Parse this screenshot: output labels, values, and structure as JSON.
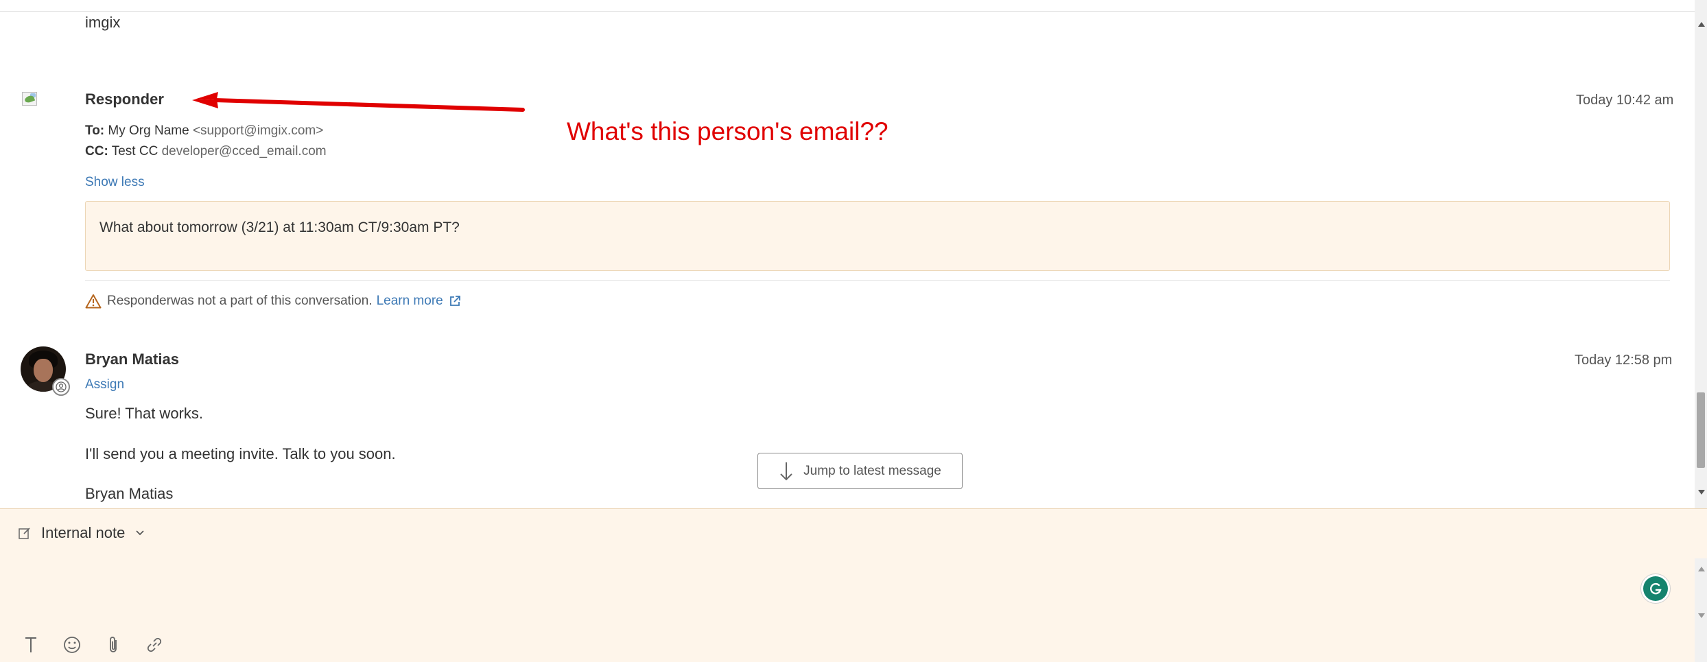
{
  "previous_message": {
    "signature": "imgix"
  },
  "responder_message": {
    "sender": "Responder",
    "time": "Today 10:42 am",
    "to_label": "To:",
    "to_name": "My Org Name",
    "to_email": "<support@imgix.com>",
    "cc_label": "CC:",
    "cc_name": "Test CC",
    "cc_email": "developer@cced_email.com",
    "show_less": "Show less",
    "body": "What about tomorrow (3/21) at 11:30am CT/9:30am PT?",
    "warning_text": "Responderwas not a part of this conversation.",
    "learn_more": "Learn more"
  },
  "annotation": {
    "text": "What's this person's email??",
    "color": "#e00000"
  },
  "bryan_message": {
    "sender": "Bryan Matias",
    "time": "Today 12:58 pm",
    "assign": "Assign",
    "lines": [
      "Sure! That works.",
      "I'll send you a meeting invite. Talk to you soon.",
      "Bryan Matias"
    ]
  },
  "jump_button": {
    "label": "Jump to latest message",
    "icon": "arrow-down-icon"
  },
  "composer": {
    "note_type": "Internal note",
    "background": "#fef5ea",
    "toolbar_icons": [
      "text-format-icon",
      "emoji-icon",
      "attachment-icon",
      "link-icon"
    ]
  },
  "colors": {
    "link": "#3d79b5",
    "grammarly": "#15836e"
  }
}
